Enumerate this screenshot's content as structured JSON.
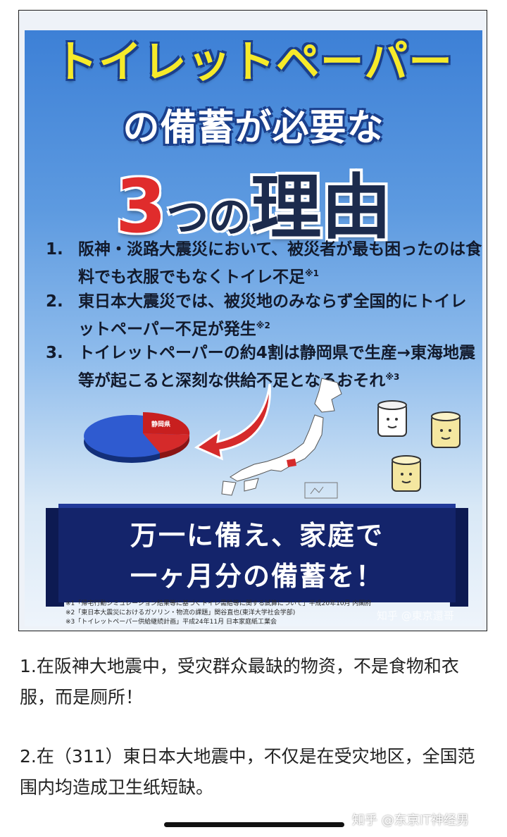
{
  "poster": {
    "title_line1": "トイレットペーパー",
    "title_line2": "の備蓄が必要な",
    "title_num": "3",
    "title_mid": "つの",
    "title_big": "理由",
    "reasons": [
      {
        "num": "1.",
        "text": "阪神・淡路大震災において、被災者が最も困ったのは食料でも衣服でもなくトイレ不足",
        "note": "※1"
      },
      {
        "num": "2.",
        "text": "東日本大震災では、被災地のみならず全国的にトイレットペーパー不足が発生",
        "note": "※2"
      },
      {
        "num": "3.",
        "text": "トイレットペーパーの約4割は静岡県で生産→東海地震等が起こると深刻な供給不足となるおそれ",
        "note": "※3"
      }
    ],
    "pie_label": "静岡県",
    "pie_share": 0.4,
    "banner_line1": "万一に備え、家庭で",
    "banner_line2": "一ヶ月分の備蓄を！",
    "footnotes": [
      "※1「帰宅行動シミュレーション結果等に基づくトイレ需給等に関する試算について」平成20年10月 内閣府",
      "※2「東日本大震災におけるガソリン・物流の課題」関谷直也(東洋大学社会学部)",
      "※3「トイレットペーパー供給継続計画」平成24年11月 日本家庭紙工業会"
    ],
    "watermark": "知乎 @東京還哥"
  },
  "article": {
    "p1": "1.在阪神大地震中，受灾群众最缺的物资，不是食物和衣服，而是厕所！",
    "p2": "2.在（311）東日本大地震中，不仅是在受灾地区，全国范围内均造成卫生纸短缺。"
  },
  "overlay_watermark": "知乎 @东京IT神经男",
  "colors": {
    "title_yellow": "#f6ea2a",
    "accent_red": "#e02c2c",
    "banner_navy": "#14246b",
    "sky_blue": "#3d80d6"
  }
}
